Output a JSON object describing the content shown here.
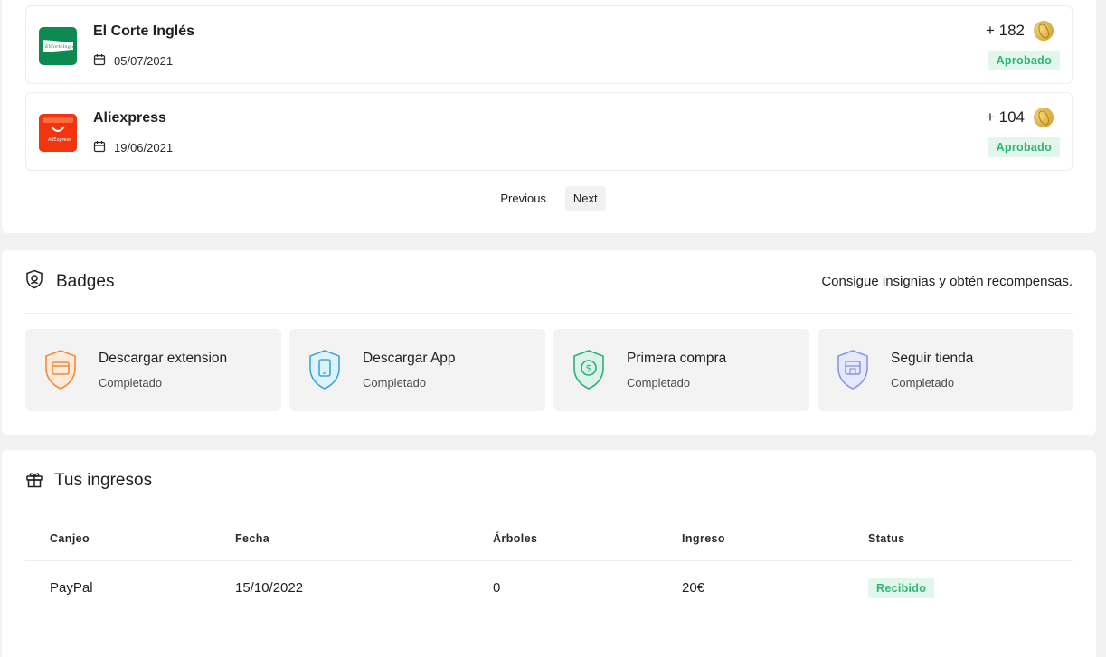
{
  "transactions": {
    "items": [
      {
        "store": "El Corte Inglés",
        "date": "05/07/2021",
        "points": "+ 182",
        "status": "Aprobado",
        "logo_color": "#0d8a4f",
        "logo_text": "ElCorteIngles"
      },
      {
        "store": "Aliexpress",
        "date": "19/06/2021",
        "points": "+ 104",
        "status": "Aprobado",
        "logo_color": "#f2350f",
        "logo_text": "AliExpress"
      }
    ],
    "pagination": {
      "previous": "Previous",
      "next": "Next"
    }
  },
  "badges": {
    "title": "Badges",
    "subtitle": "Consigue insignias y obtén recompensas.",
    "items": [
      {
        "title": "Descargar extension",
        "status": "Completado",
        "icon": "browser-shield-icon",
        "color": "#f08a3a"
      },
      {
        "title": "Descargar App",
        "status": "Completado",
        "icon": "phone-shield-icon",
        "color": "#3ba8d8"
      },
      {
        "title": "Primera compra",
        "status": "Completado",
        "icon": "dollar-shield-icon",
        "color": "#2fae7a"
      },
      {
        "title": "Seguir tienda",
        "status": "Completado",
        "icon": "store-shield-icon",
        "color": "#8a95e8"
      }
    ]
  },
  "income": {
    "title": "Tus ingresos",
    "columns": [
      "Canjeo",
      "Fecha",
      "Árboles",
      "Ingreso",
      "Status"
    ],
    "rows": [
      {
        "canjeo": "PayPal",
        "fecha": "15/10/2022",
        "arboles": "0",
        "ingreso": "20€",
        "status": "Recibido"
      }
    ]
  },
  "colors": {
    "status_green": "#2cb772",
    "status_bg": "#e3f6ec"
  }
}
